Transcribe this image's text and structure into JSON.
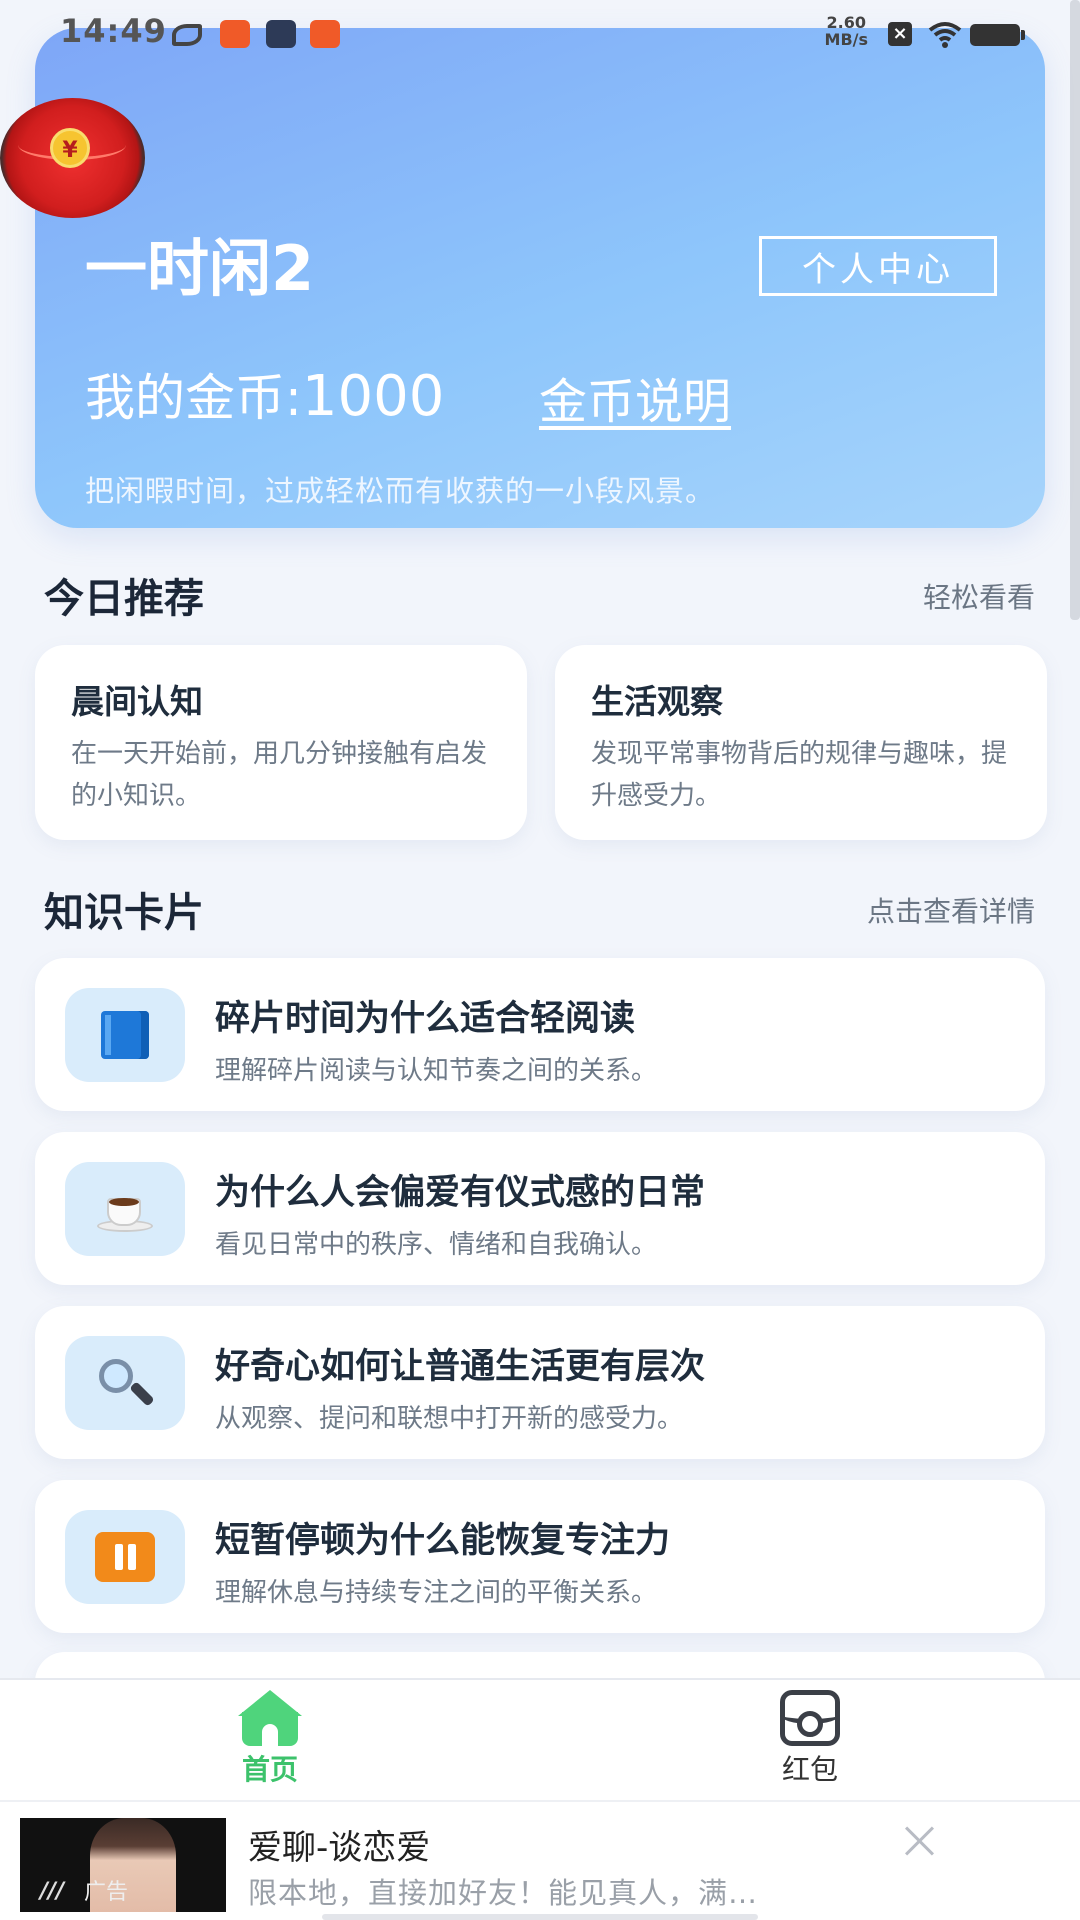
{
  "status_bar": {
    "time": "14:49",
    "net_speed_value": "2.60",
    "net_speed_unit": "MB/s"
  },
  "header": {
    "app_name": "一时闲2",
    "profile_button": "个人中心",
    "coins_label": "我的金币:",
    "coins_value": "1000",
    "coins_explain_link": "金币说明",
    "tagline": "把闲暇时间，过成轻松而有收获的一小段风景。"
  },
  "floating_red_packet": {
    "symbol": "¥"
  },
  "recommend": {
    "title": "今日推荐",
    "more_link": "轻松看看",
    "cards": [
      {
        "title": "晨间认知",
        "desc": "在一天开始前，用几分钟接触有启发的小知识。"
      },
      {
        "title": "生活观察",
        "desc": "发现平常事物背后的规律与趣味，提升感受力。"
      }
    ]
  },
  "knowledge": {
    "title": "知识卡片",
    "more_link": "点击查看详情",
    "cards": [
      {
        "icon": "book-icon",
        "title": "碎片时间为什么适合轻阅读",
        "desc": "理解碎片阅读与认知节奏之间的关系。"
      },
      {
        "icon": "coffee-icon",
        "title": "为什么人会偏爱有仪式感的日常",
        "desc": "看见日常中的秩序、情绪和自我确认。"
      },
      {
        "icon": "magnifier-icon",
        "title": "好奇心如何让普通生活更有层次",
        "desc": "从观察、提问和联想中打开新的感受力。"
      },
      {
        "icon": "pause-icon",
        "title": "短暂停顿为什么能恢复专注力",
        "desc": "理解休息与持续专注之间的平衡关系。"
      }
    ]
  },
  "bottom_nav": {
    "items": [
      {
        "label": "首页",
        "icon": "home-icon",
        "active": true
      },
      {
        "label": "红包",
        "icon": "red-packet-icon",
        "active": false
      }
    ],
    "active_color": "#3cc26b"
  },
  "ad": {
    "badge": "广告",
    "title": "爱聊-谈恋爱",
    "desc": "限本地，直接加好友！能见真人，满…"
  },
  "colors": {
    "hero_gradient_start": "#7ea6f7",
    "hero_gradient_end": "#a6d4fb",
    "background": "#f2f5fb"
  }
}
